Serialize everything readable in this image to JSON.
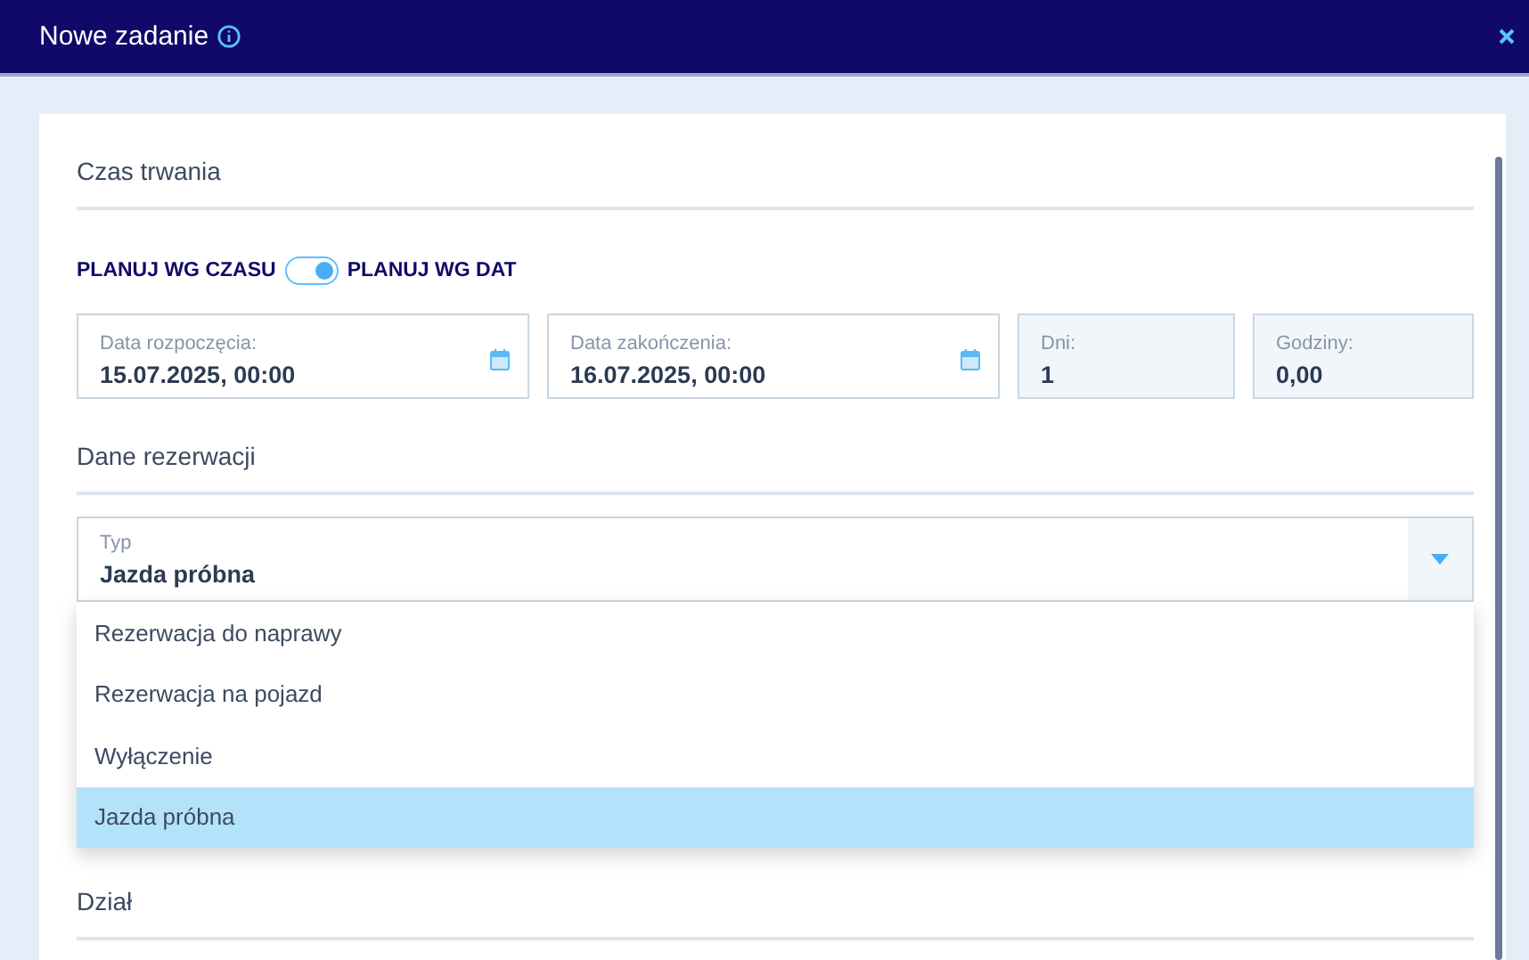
{
  "window": {
    "title": "Nowe zadanie"
  },
  "duration": {
    "heading": "Czas trwania",
    "mode_toggle": {
      "left_label": "PLANUJ WG CZASU",
      "right_label": "PLANUJ WG DAT",
      "on": true
    },
    "fields": [
      {
        "kind": "date",
        "label": "Data rozpoczęcia:",
        "value": "15.07.2025, 00:00"
      },
      {
        "kind": "date",
        "label": "Data zakończenia:",
        "value": "16.07.2025, 00:00"
      },
      {
        "kind": "readonly",
        "label": "Dni:",
        "value": "1"
      },
      {
        "kind": "readonly",
        "label": "Godziny:",
        "value": "0,00"
      }
    ]
  },
  "reservation": {
    "heading": "Dane rezerwacji",
    "type_select": {
      "label": "Typ",
      "value": "Jazda próbna",
      "expanded": true,
      "options": [
        {
          "label": "Rezerwacja do naprawy",
          "selected": false
        },
        {
          "label": "Rezerwacja na pojazd",
          "selected": false
        },
        {
          "label": "Wyłączenie",
          "selected": false
        },
        {
          "label": "Jazda próbna",
          "selected": true
        }
      ]
    }
  },
  "department": {
    "heading": "Dział"
  }
}
